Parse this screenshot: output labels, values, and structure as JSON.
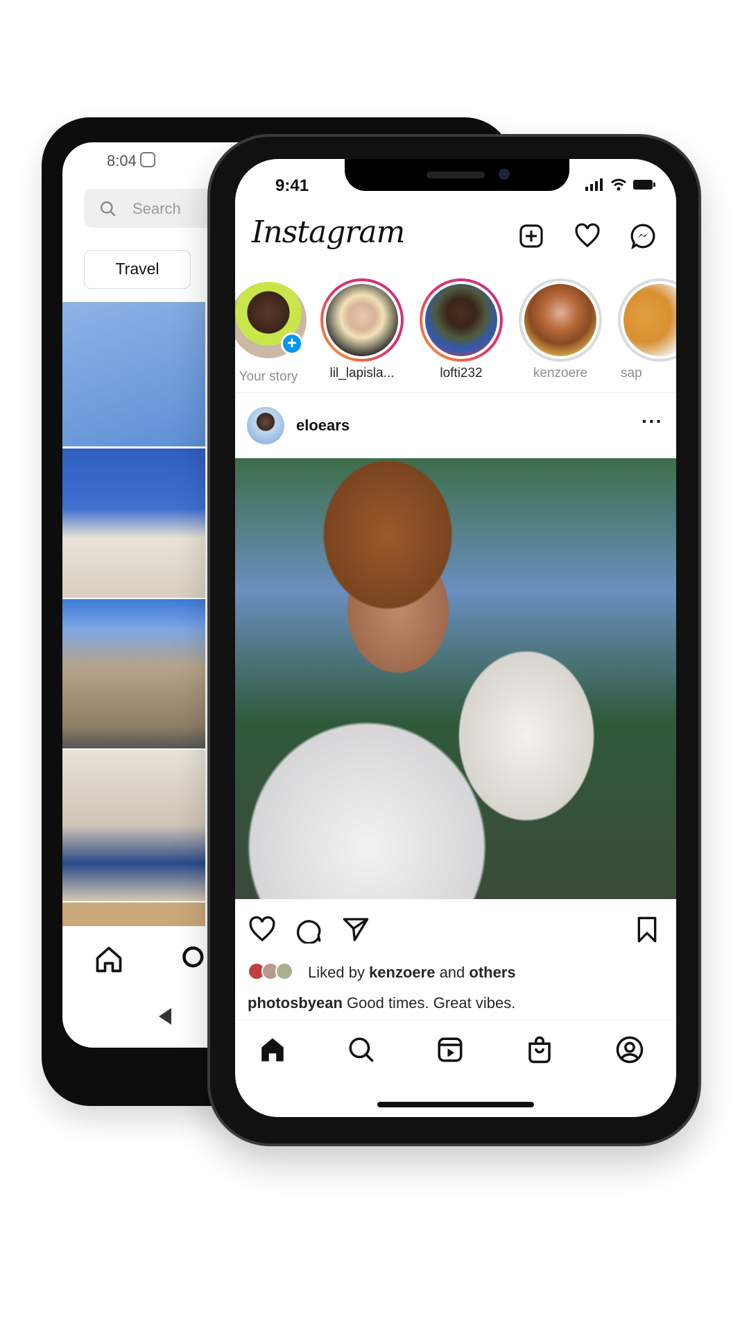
{
  "back_phone": {
    "status_time": "8:04",
    "search_placeholder": "Search",
    "chip": "Travel"
  },
  "front_phone": {
    "status_time": "9:41",
    "logo": "Instagram",
    "stories": [
      {
        "label": "Your story",
        "ring": "none"
      },
      {
        "label": "lil_lapisla...",
        "ring": "active"
      },
      {
        "label": "lofti232",
        "ring": "active"
      },
      {
        "label": "kenzoere",
        "ring": "seen"
      },
      {
        "label": "sap",
        "ring": "seen"
      }
    ],
    "post": {
      "username": "eloears",
      "liked_prefix": "Liked by ",
      "liked_user": "kenzoere",
      "liked_mid": " and ",
      "liked_others": "others",
      "caption_user": "photosbyean",
      "caption_text": " Good times. Great vibes."
    },
    "nav": [
      "home-icon",
      "search-icon",
      "reels-icon",
      "shop-icon",
      "profile-icon"
    ],
    "colors": {
      "add_story_badge": "#0095f6",
      "ring_start": "#f9a12e",
      "ring_end": "#c13584"
    }
  }
}
